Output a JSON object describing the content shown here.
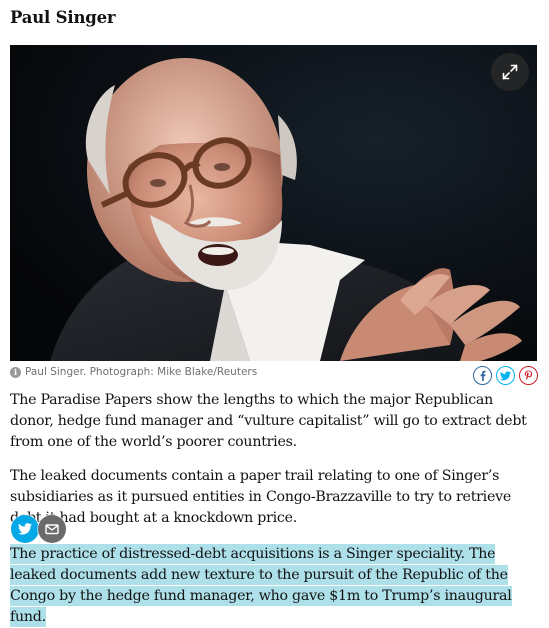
{
  "section": {
    "heading": "Paul Singer"
  },
  "image": {
    "alt": "Paul Singer",
    "caption": "Paul Singer. Photograph: Mike Blake/Reuters"
  },
  "icons": {
    "expand": "expand-icon",
    "info": "info-icon",
    "facebook": "facebook-icon",
    "twitter": "twitter-icon",
    "pinterest": "pinterest-icon",
    "email": "email-icon"
  },
  "body": {
    "paragraphs": [
      "The Paradise Papers show the lengths to which the major Republican donor, hedge fund manager and “vulture capitalist” will go to extract debt from one of the world’s poorer countries.",
      "The leaked documents contain a paper trail relating to one of Singer’s subsidiaries as it pursued entities in Congo-Brazzaville to try to retrieve debt it had bought at a knockdown price.",
      "The practice of distressed-debt acquisitions is a Singer speciality. The leaked documents add new texture to the pursuit of the Republic of the Congo by the hedge fund manager, who gave $1m to Trump’s inaugural fund."
    ]
  },
  "colors": {
    "highlight": "#aee0ea",
    "facebook": "#3067a3",
    "twitter": "#03b3ee",
    "pinterest": "#cb1f27"
  }
}
